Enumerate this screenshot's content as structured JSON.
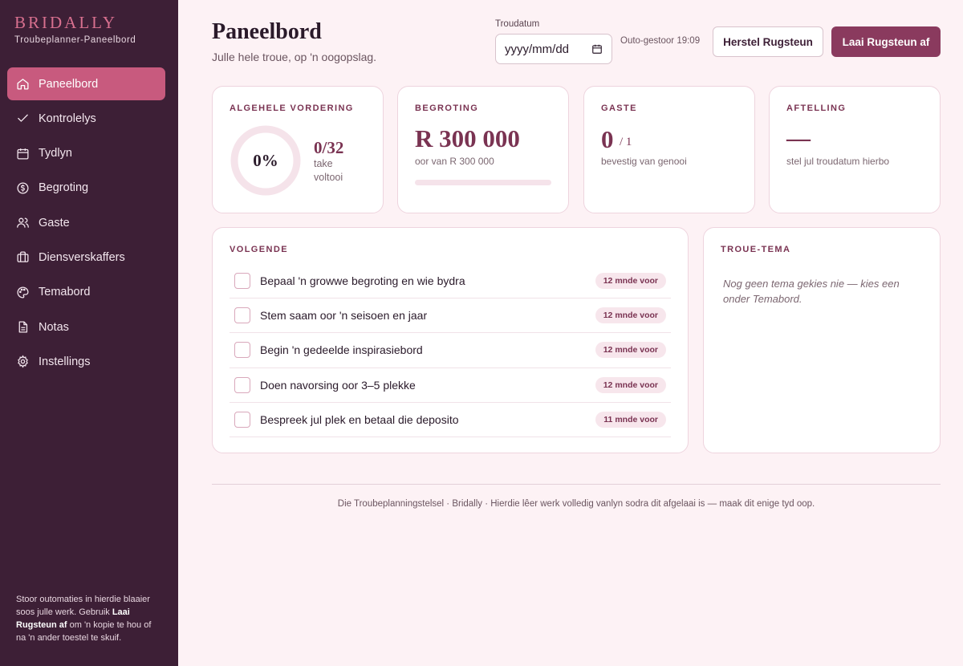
{
  "sidebar": {
    "brand": "BRIDALLY",
    "subtitle": "Troubeplanner-Paneelbord",
    "items": [
      {
        "label": "Paneelbord",
        "icon": "home-icon"
      },
      {
        "label": "Kontrolelys",
        "icon": "check-icon"
      },
      {
        "label": "Tydlyn",
        "icon": "calendar-icon"
      },
      {
        "label": "Begroting",
        "icon": "coin-icon"
      },
      {
        "label": "Gaste",
        "icon": "users-icon"
      },
      {
        "label": "Diensverskaffers",
        "icon": "briefcase-icon"
      },
      {
        "label": "Temabord",
        "icon": "palette-icon"
      },
      {
        "label": "Notas",
        "icon": "document-icon"
      },
      {
        "label": "Instellings",
        "icon": "gear-icon"
      }
    ],
    "footer_pre": "Stoor outomaties in hierdie blaaier soos julle werk. Gebruik ",
    "footer_bold": "Laai Rugsteun af",
    "footer_post": " om 'n kopie te hou of na 'n ander toestel te skuif."
  },
  "header": {
    "title": "Paneelbord",
    "subtitle": "Julle hele troue, op 'n oogopslag.",
    "date_label": "Troudatum",
    "date_placeholder": "yyyy/mm/dd",
    "autosave": "Outo-gestoor 19:09",
    "restore_button": "Herstel Rugsteun",
    "download_button": "Laai Rugsteun af"
  },
  "stats": {
    "progress": {
      "label": "ALGEHELE VORDERING",
      "percent": "0%",
      "count": "0/32",
      "unit": "take voltooi",
      "fraction": 0
    },
    "budget": {
      "label": "BEGROTING",
      "amount": "R 300 000",
      "sub": "oor van R 300 000",
      "spent_fraction": 0
    },
    "guests": {
      "label": "GASTE",
      "value": "0",
      "total": "/ 1",
      "sub": "bevestig van genooi"
    },
    "countdown": {
      "label": "AFTELLING",
      "value": "—",
      "sub": "stel jul troudatum hierbo"
    }
  },
  "next": {
    "label": "VOLGENDE",
    "tasks": [
      {
        "text": "Bepaal 'n growwe begroting en wie bydra",
        "when": "12 mnde voor"
      },
      {
        "text": "Stem saam oor 'n seisoen en jaar",
        "when": "12 mnde voor"
      },
      {
        "text": "Begin 'n gedeelde inspirasiebord",
        "when": "12 mnde voor"
      },
      {
        "text": "Doen navorsing oor 3–5 plekke",
        "when": "12 mnde voor"
      },
      {
        "text": "Bespreek jul plek en betaal die deposito",
        "when": "11 mnde voor"
      }
    ]
  },
  "theme": {
    "label": "TROUE-TEMA",
    "empty": "Nog geen tema gekies nie — kies een onder Temabord."
  },
  "footer": "Die Troubeplanningstelsel · Bridally · Hierdie lêer werk volledig vanlyn sodra dit afgelaai is — maak dit enige tyd oop.",
  "colors": {
    "sidebar": "#3d1f36",
    "accent": "#c85a7e",
    "primary": "#8a3a5e",
    "background": "#fdf2f5"
  }
}
